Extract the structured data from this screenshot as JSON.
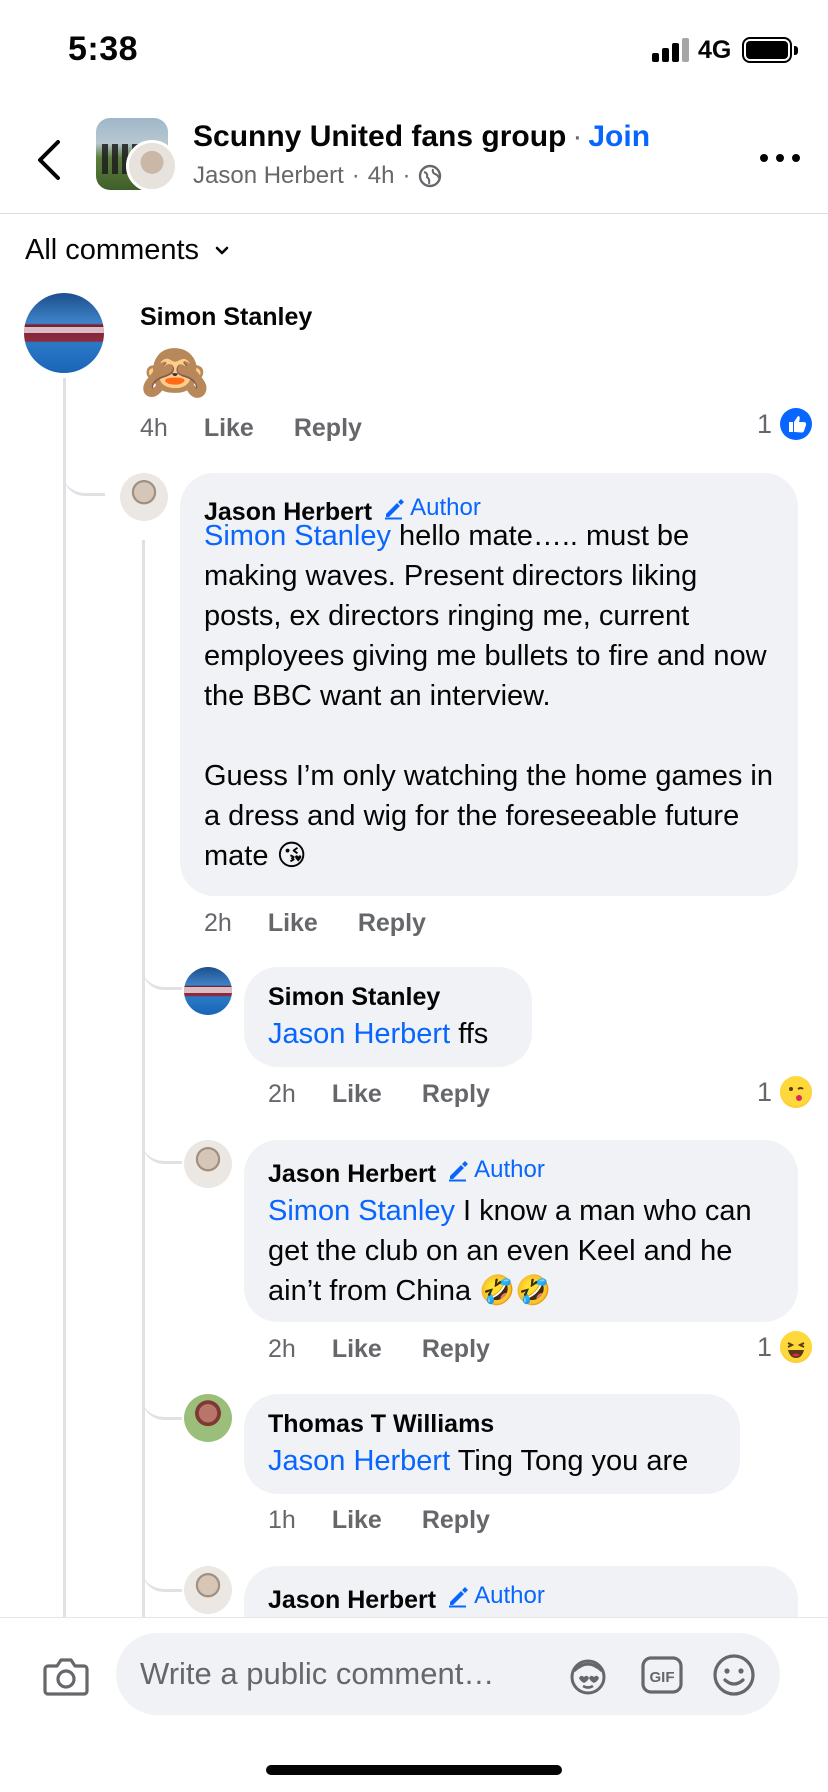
{
  "status_bar": {
    "time": "5:38",
    "network": "4G"
  },
  "header": {
    "group_name": "Scunny United fans group",
    "separator": "·",
    "join_label": "Join",
    "author": "Jason Herbert",
    "time": "4h",
    "sub_sep": "·",
    "icons": [
      "back-chevron-icon",
      "globe-icon",
      "more-icon"
    ]
  },
  "filter": {
    "label": "All comments"
  },
  "comments": [
    {
      "author": "Simon Stanley",
      "emoji": "🙈",
      "time": "4h",
      "like": "Like",
      "reply": "Reply",
      "reaction_count": "1",
      "reaction_icon": "like-icon"
    },
    {
      "author": "Jason Herbert",
      "author_badge": "Author",
      "mention": "Simon Stanley",
      "text_line1": " hello mate….. must be",
      "text_rest": "making waves. Present directors liking posts, ex directors ringing me, current employees giving me bullets to fire and now the BBC want an interview.",
      "text_para2": "Guess I’m only watching the home games in a dress and wig for the foreseeable future mate 😘",
      "time": "2h",
      "like": "Like",
      "reply": "Reply"
    },
    {
      "author": "Simon Stanley",
      "mention": "Jason Herbert",
      "text": " ffs",
      "time": "2h",
      "like": "Like",
      "reply": "Reply",
      "reaction_count": "1",
      "reaction_icon": "kiss-emoji-icon"
    },
    {
      "author": "Jason Herbert",
      "author_badge": "Author",
      "mention": "Simon Stanley",
      "text": " I know a man who can get the club on an even Keel and he ain’t from China 🤣🤣",
      "time": "2h",
      "like": "Like",
      "reply": "Reply",
      "reaction_count": "1",
      "reaction_icon": "haha-emoji-icon"
    },
    {
      "author": "Thomas T Williams",
      "mention": "Jason Herbert",
      "text": " Ting Tong you are",
      "time": "1h",
      "like": "Like",
      "reply": "Reply"
    },
    {
      "author": "Jason Herbert",
      "author_badge": "Author"
    }
  ],
  "composer": {
    "placeholder": "Write a public comment…",
    "icons": [
      "camera-icon",
      "avatar-sticker-icon",
      "gif-icon",
      "emoji-icon"
    ],
    "gif_label": "GIF"
  },
  "colors": {
    "link": "#0866ff",
    "bubble": "#f0f2f5",
    "muted": "#65676b"
  }
}
